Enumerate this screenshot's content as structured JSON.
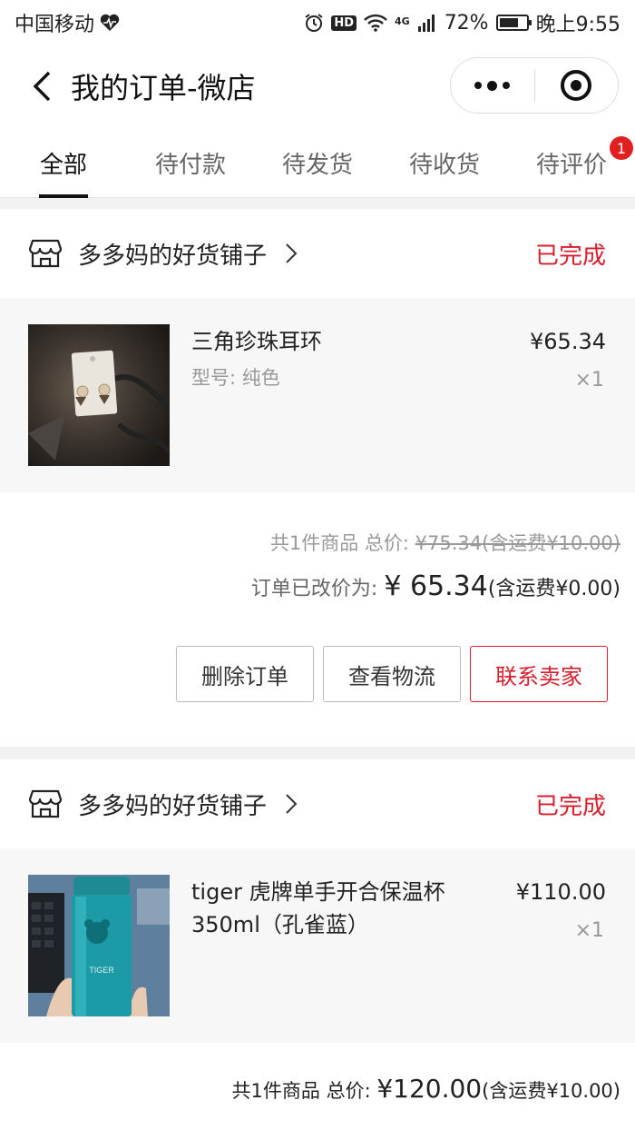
{
  "status_bar": {
    "carrier": "中国移动",
    "hd": "HD",
    "network": "4G",
    "battery": "72%",
    "battery_level": 0.72,
    "time": "晚上9:55"
  },
  "nav": {
    "title": "我的订单-微店"
  },
  "tabs": [
    {
      "label": "全部",
      "active": true
    },
    {
      "label": "待付款"
    },
    {
      "label": "待发货"
    },
    {
      "label": "待收货"
    },
    {
      "label": "待评价",
      "badge": "1"
    }
  ],
  "orders": [
    {
      "shop": "多多妈的好货铺子",
      "status": "已完成",
      "item": {
        "title": "三角珍珠耳环",
        "spec": "型号: 纯色",
        "price": "¥65.34",
        "qty": "×1"
      },
      "summary": {
        "prefix": "共1件商品 总价: ",
        "original_total": "¥75.34",
        "original_fee": "(含运费¥10.00)",
        "modified_label": "订单已改价为: ",
        "modified_total": "¥ 65.34",
        "modified_fee": "(含运费¥0.00)"
      },
      "buttons": {
        "delete": "删除订单",
        "logistics": "查看物流",
        "contact": "联系卖家"
      }
    },
    {
      "shop": "多多妈的好货铺子",
      "status": "已完成",
      "item": {
        "title": "tiger 虎牌单手开合保温杯350ml（孔雀蓝）",
        "price": "¥110.00",
        "qty": "×1",
        "image_text": "TIGER"
      },
      "summary": {
        "prefix": "共1件商品 总价: ",
        "total": "¥120.00",
        "fee": "(含运费¥10.00)"
      }
    }
  ],
  "colors": {
    "accent_red": "#d81e2c",
    "badge_red": "#e02020"
  }
}
